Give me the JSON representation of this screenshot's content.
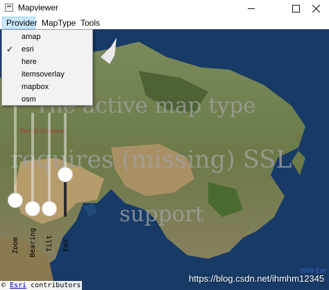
{
  "window": {
    "title": "Mapviewer"
  },
  "menubar": {
    "items": [
      "Provider",
      "MapType",
      "Tools"
    ]
  },
  "provider_menu": {
    "items": [
      {
        "label": "amap",
        "checked": false
      },
      {
        "label": "esri",
        "checked": true
      },
      {
        "label": "here",
        "checked": false
      },
      {
        "label": "itemsoverlay",
        "checked": false
      },
      {
        "label": "mapbox",
        "checked": false
      },
      {
        "label": "osm",
        "checked": false
      }
    ]
  },
  "map": {
    "overlay_lines": [
      "The active map type",
      "requires (missing) SSL",
      "support"
    ],
    "qt_label": "The Qt Company",
    "copyright": {
      "link": "Esri",
      "rest": " contributors"
    },
    "year": "2009 Esri",
    "watermark": "https://blog.csdn.net/ihmhm12345"
  },
  "sliders": [
    {
      "label": "Zoom",
      "value": 0.05
    },
    {
      "label": "Bearing",
      "value": 0.0
    },
    {
      "label": "Tilt",
      "value": 0.0
    },
    {
      "label": "FoV",
      "value": 0.45
    }
  ],
  "colors": {
    "menu_highlight": "#cce8ff",
    "ocean": "#173a66"
  }
}
